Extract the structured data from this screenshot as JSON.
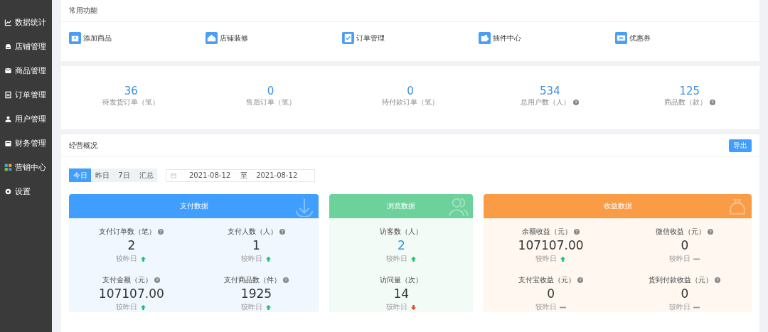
{
  "sidebar": {
    "items": [
      {
        "label": "数据统计",
        "selected": false
      },
      {
        "label": "店铺管理",
        "selected": false
      },
      {
        "label": "商品管理",
        "selected": false
      },
      {
        "label": "订单管理",
        "selected": false
      },
      {
        "label": "用户管理",
        "selected": false
      },
      {
        "label": "财务管理",
        "selected": false
      },
      {
        "label": "营销中心",
        "selected": false
      },
      {
        "label": "设置",
        "selected": false
      }
    ]
  },
  "shortcuts": {
    "title": "常用功能",
    "items": [
      {
        "label": "添加商品"
      },
      {
        "label": "店铺装修"
      },
      {
        "label": "订单管理"
      },
      {
        "label": "插件中心"
      },
      {
        "label": "优惠券"
      }
    ]
  },
  "stats": [
    {
      "value": "36",
      "label": "待发货订单（笔）",
      "help": false
    },
    {
      "value": "0",
      "label": "售后订单（笔）",
      "help": false
    },
    {
      "value": "0",
      "label": "待付款订单（笔）",
      "help": false
    },
    {
      "value": "534",
      "label": "总用户数（人）",
      "help": true
    },
    {
      "value": "125",
      "label": "商品数（款）",
      "help": true
    }
  ],
  "overview": {
    "title": "经营概况",
    "export_button": "导出",
    "tabs": [
      {
        "label": "今日",
        "selected": true
      },
      {
        "label": "昨日",
        "selected": false
      },
      {
        "label": "7日",
        "selected": false
      },
      {
        "label": "汇总",
        "selected": false
      }
    ],
    "date_range": {
      "start": "2021-08-12",
      "separator": "至",
      "end": "2021-08-12"
    },
    "sections": [
      {
        "title": "支付数据",
        "color": "#409eff",
        "metrics": [
          {
            "label": "支付订单数（笔）",
            "help": true,
            "value": "2",
            "highlighted": false,
            "compare": "较昨日",
            "kind": "up"
          },
          {
            "label": "支付人数（人）",
            "help": true,
            "value": "1",
            "highlighted": false,
            "compare": "较昨日",
            "kind": "up"
          },
          {
            "label": "支付金额（元）",
            "help": true,
            "value": "107107.00",
            "highlighted": false,
            "compare": "较昨日",
            "kind": "up"
          },
          {
            "label": "支付商品数（件）",
            "help": true,
            "value": "1925",
            "highlighted": false,
            "compare": "较昨日",
            "kind": "up"
          }
        ]
      },
      {
        "title": "浏览数据",
        "color": "#6dd19b",
        "metrics": [
          {
            "label": "访客数（人）",
            "help": false,
            "value": "2",
            "highlighted": true,
            "compare": "较昨日",
            "kind": "up"
          },
          {
            "label": "访问量（次）",
            "help": false,
            "value": "14",
            "highlighted": false,
            "compare": "较昨日",
            "kind": "down"
          }
        ]
      },
      {
        "title": "收益数据",
        "color": "#fa9b45",
        "metrics": [
          {
            "label": "余额收益（元）",
            "help": true,
            "value": "107107.00",
            "highlighted": false,
            "compare": "较昨日",
            "kind": "up"
          },
          {
            "label": "微信收益（元）",
            "help": true,
            "value": "0",
            "highlighted": false,
            "compare": "较昨日",
            "kind": "flat"
          },
          {
            "label": "支付宝收益（元）",
            "help": true,
            "value": "0",
            "highlighted": false,
            "compare": "较昨日",
            "kind": "flat"
          },
          {
            "label": "货到付款收益（元）",
            "help": true,
            "value": "0",
            "highlighted": false,
            "compare": "较昨日",
            "kind": "flat"
          }
        ]
      }
    ]
  }
}
